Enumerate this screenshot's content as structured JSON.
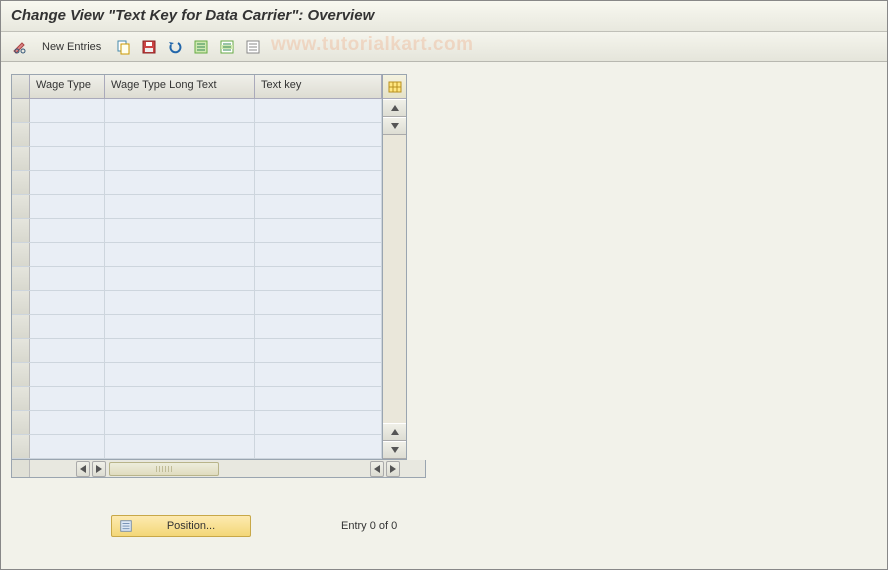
{
  "title": "Change View \"Text Key for Data Carrier\": Overview",
  "toolbar": {
    "new_entries_label": "New Entries"
  },
  "watermark": "www.tutorialkart.com",
  "table": {
    "columns": {
      "wage_type": "Wage Type",
      "long_text": "Wage Type Long Text",
      "text_key": "Text key"
    },
    "row_count": 15
  },
  "footer": {
    "position_label": "Position...",
    "entry_status": "Entry 0 of 0"
  }
}
